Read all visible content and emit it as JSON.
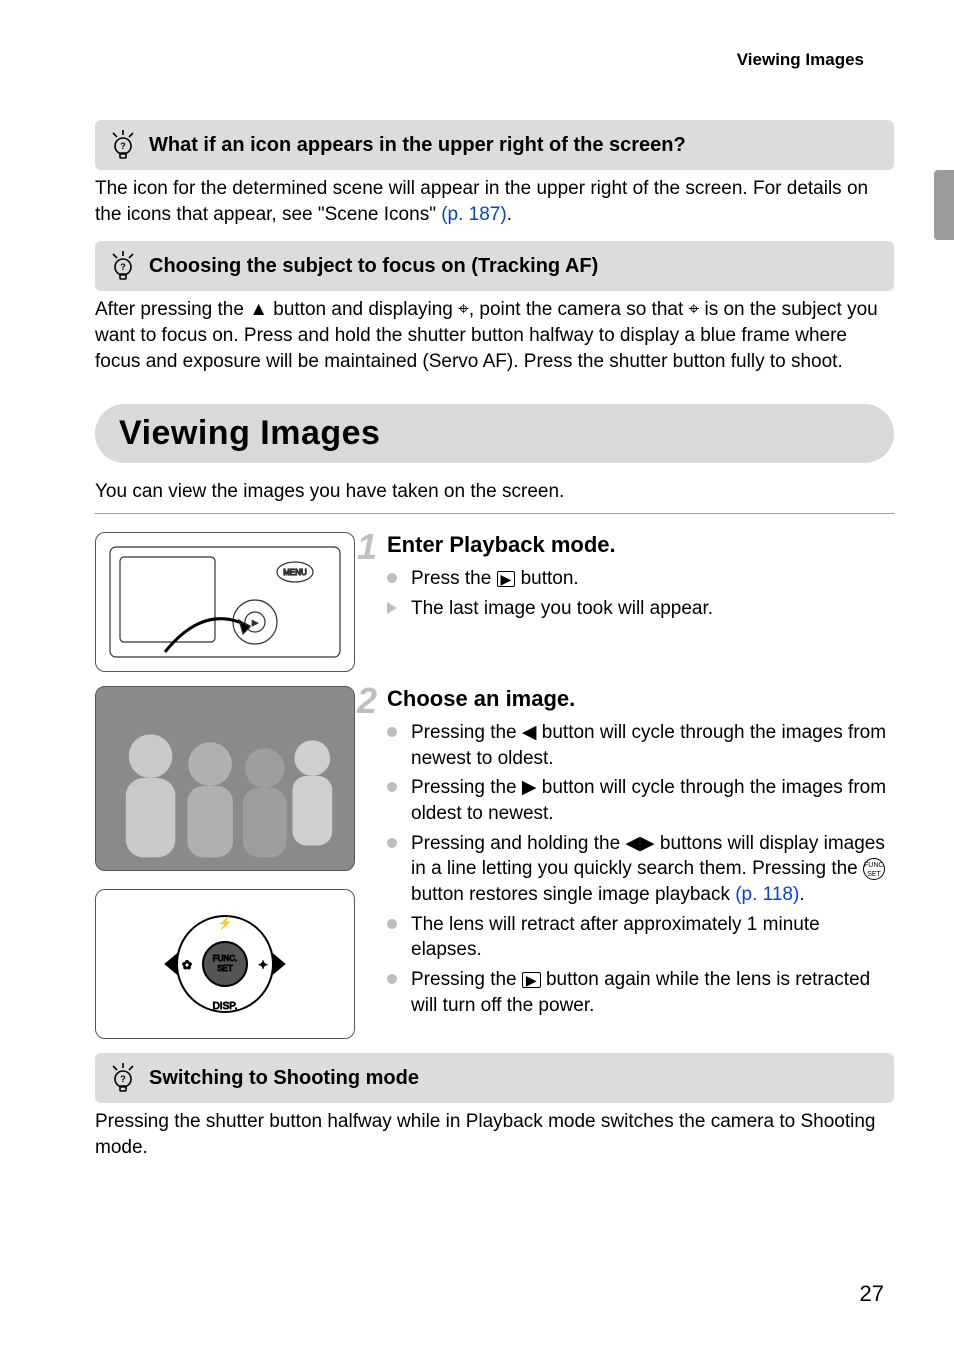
{
  "header": "Viewing Images",
  "tip1": {
    "title": "What if an icon appears in the upper right of the screen?",
    "body_a": "The icon for the determined scene will appear in the upper right of the screen. For details on the icons that appear, see \"Scene Icons\" ",
    "link": "(p. 187)",
    "body_b": "."
  },
  "tip2": {
    "title": "Choosing the subject to focus on (Tracking AF)",
    "body": "After pressing the ▲ button and displaying ⌖, point the camera so that ⌖ is on the subject you want to focus on. Press and hold the shutter button halfway to display a blue frame where focus and exposure will be maintained (Servo AF). Press the shutter button fully to shoot."
  },
  "section": {
    "title": "Viewing Images",
    "intro": "You can view the images you have taken on the screen."
  },
  "step1": {
    "num": "1",
    "heading": "Enter Playback mode.",
    "b1_a": "Press the ",
    "b1_b": " button.",
    "b2": "The last image you took will appear."
  },
  "step2": {
    "num": "2",
    "heading": "Choose an image.",
    "b1": "Pressing the ◀ button will cycle through the images from newest to oldest.",
    "b2": "Pressing the ▶ button will cycle through the images from oldest to newest.",
    "b3_a": "Pressing and holding the ◀▶ buttons will display images in a line letting you quickly search them. Pressing the ",
    "b3_b": " button restores single image playback ",
    "b3_link": "(p. 118)",
    "b3_c": ".",
    "b4": "The lens will retract after approximately 1 minute elapses.",
    "b5_a": "Pressing the ",
    "b5_b": " button again while the lens is retracted will turn off the power."
  },
  "tip3": {
    "title": "Switching to Shooting mode",
    "body": "Pressing the shutter button halfway while in Playback mode switches the camera to Shooting mode."
  },
  "page_number": "27"
}
